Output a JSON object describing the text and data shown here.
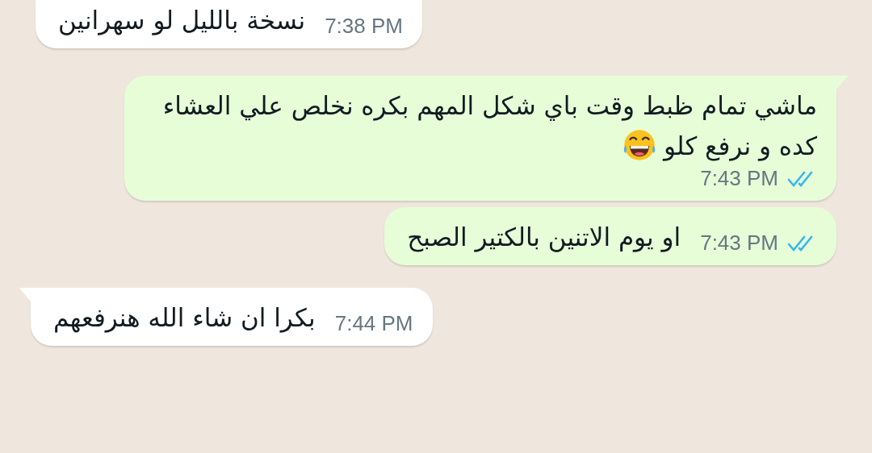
{
  "messages": [
    {
      "kind": "incoming",
      "text": "نسخة بالليل لو سهرانين",
      "time": "7:38 PM",
      "tail": false
    },
    {
      "kind": "outgoing",
      "text": "ماشي تمام ظبط وقت باي شكل المهم بكره نخلص علي العشاء كده و نرفع كلو",
      "laughing_emoji": true,
      "time": "7:43 PM",
      "tail": true,
      "read": true
    },
    {
      "kind": "outgoing",
      "text": "او يوم الاتنين بالكتير الصبح",
      "time": "7:43 PM",
      "tail": false,
      "read": true
    },
    {
      "kind": "incoming",
      "text": "بكرا ان شاء الله هنرفعهم",
      "time": "7:44 PM",
      "tail": true
    }
  ]
}
